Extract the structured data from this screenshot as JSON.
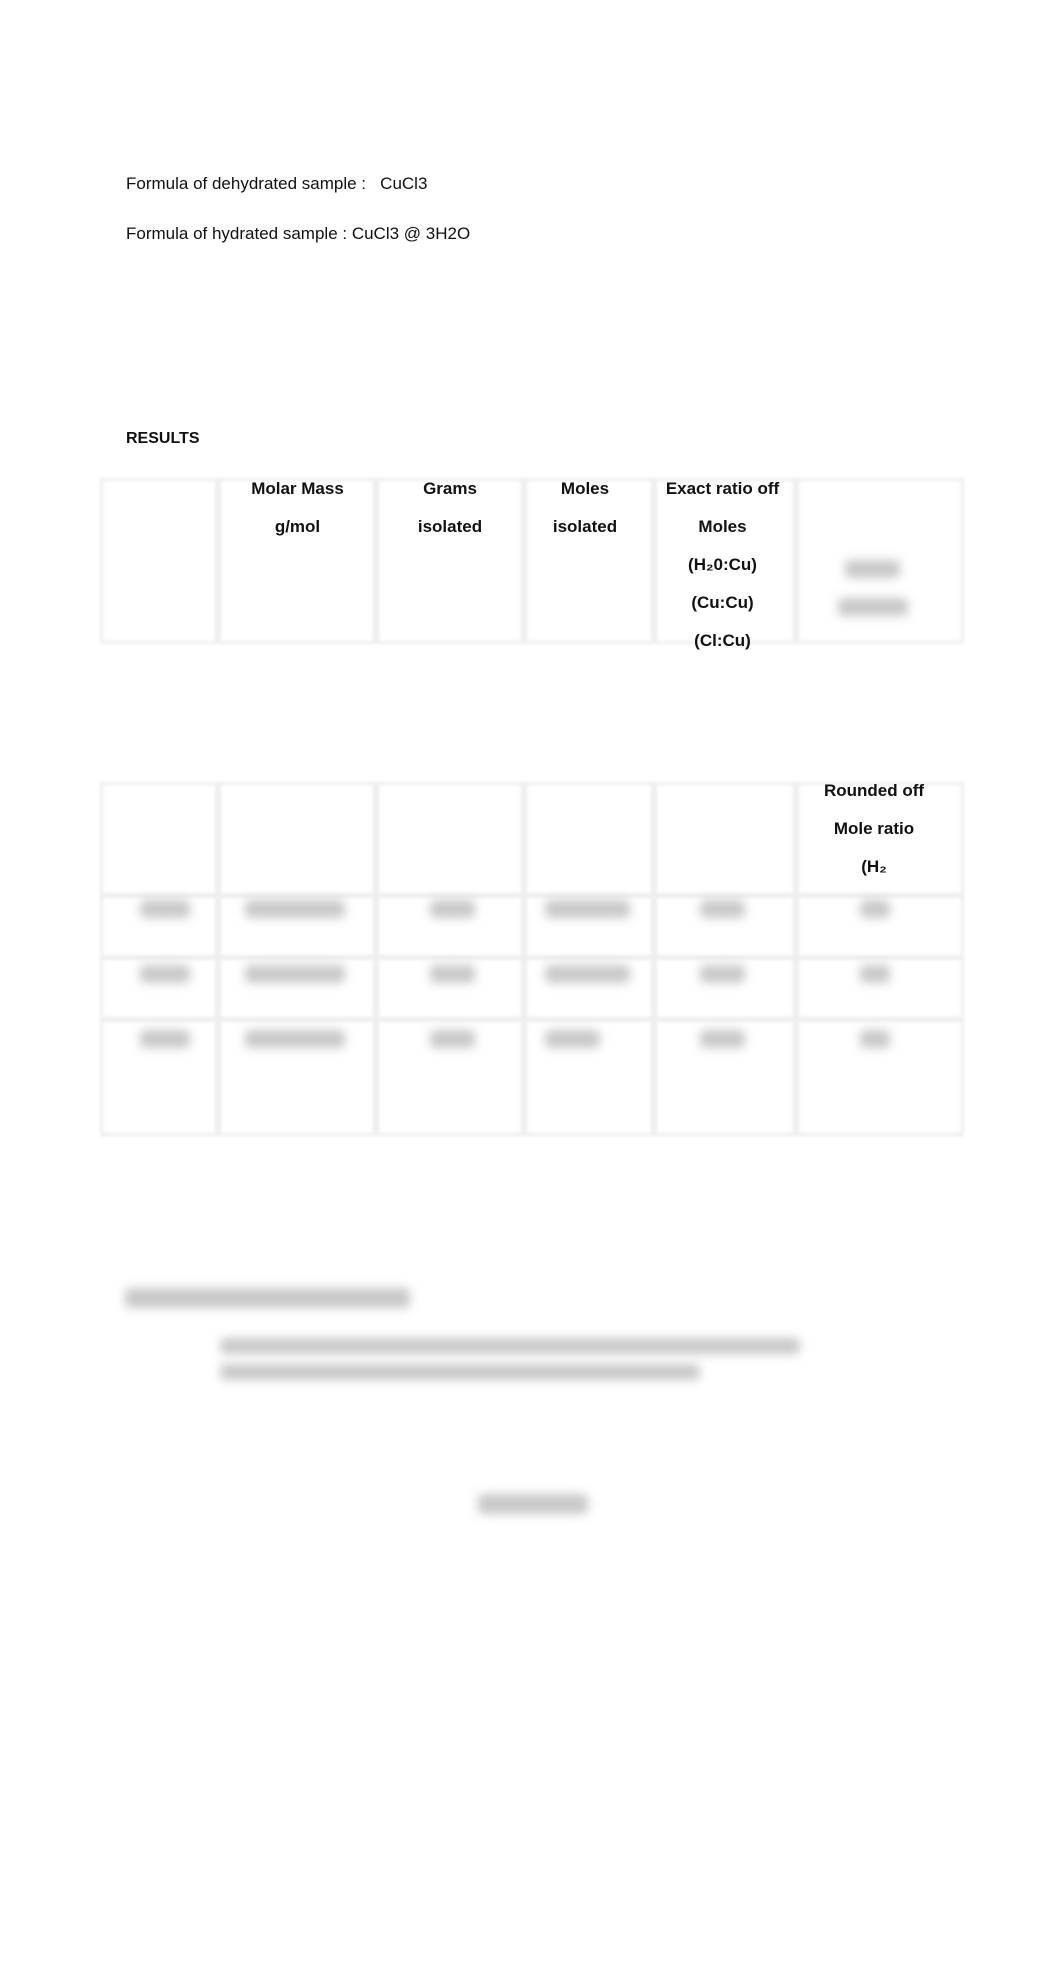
{
  "document": {
    "dehydrated_label": "Formula of dehydrated sample :   CuCl3",
    "hydrated_label": "Formula of hydrated sample : CuCl3 @ 3H2O",
    "results_heading": "RESULTS",
    "table_headers": {
      "molar_mass": [
        "Molar Mass",
        "g/mol"
      ],
      "grams": [
        "Grams",
        "isolated"
      ],
      "moles": [
        "Moles",
        "isolated"
      ],
      "exact_ratio": [
        "Exact ratio off",
        "Moles",
        "(H₂0:Cu)",
        "(Cu:Cu)",
        "(Cl:Cu)"
      ],
      "rounded_ratio": [
        "Rounded off",
        "Mole ratio",
        "(H₂"
      ]
    }
  }
}
